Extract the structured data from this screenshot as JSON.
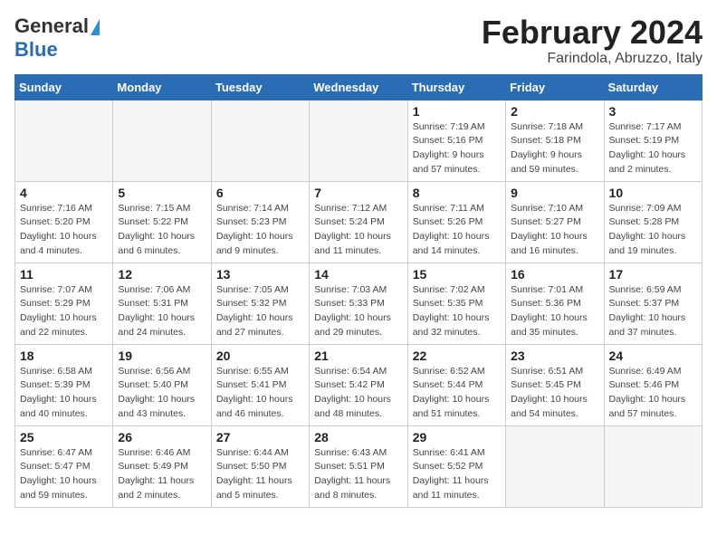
{
  "header": {
    "logo_general": "General",
    "logo_blue": "Blue",
    "month_title": "February 2024",
    "location": "Farindola, Abruzzo, Italy"
  },
  "weekdays": [
    "Sunday",
    "Monday",
    "Tuesday",
    "Wednesday",
    "Thursday",
    "Friday",
    "Saturday"
  ],
  "weeks": [
    [
      {
        "day": "",
        "sunrise": "",
        "sunset": "",
        "daylight": "",
        "empty": true
      },
      {
        "day": "",
        "sunrise": "",
        "sunset": "",
        "daylight": "",
        "empty": true
      },
      {
        "day": "",
        "sunrise": "",
        "sunset": "",
        "daylight": "",
        "empty": true
      },
      {
        "day": "",
        "sunrise": "",
        "sunset": "",
        "daylight": "",
        "empty": true
      },
      {
        "day": "1",
        "sunrise": "Sunrise: 7:19 AM",
        "sunset": "Sunset: 5:16 PM",
        "daylight": "Daylight: 9 hours and 57 minutes.",
        "empty": false
      },
      {
        "day": "2",
        "sunrise": "Sunrise: 7:18 AM",
        "sunset": "Sunset: 5:18 PM",
        "daylight": "Daylight: 9 hours and 59 minutes.",
        "empty": false
      },
      {
        "day": "3",
        "sunrise": "Sunrise: 7:17 AM",
        "sunset": "Sunset: 5:19 PM",
        "daylight": "Daylight: 10 hours and 2 minutes.",
        "empty": false
      }
    ],
    [
      {
        "day": "4",
        "sunrise": "Sunrise: 7:16 AM",
        "sunset": "Sunset: 5:20 PM",
        "daylight": "Daylight: 10 hours and 4 minutes.",
        "empty": false
      },
      {
        "day": "5",
        "sunrise": "Sunrise: 7:15 AM",
        "sunset": "Sunset: 5:22 PM",
        "daylight": "Daylight: 10 hours and 6 minutes.",
        "empty": false
      },
      {
        "day": "6",
        "sunrise": "Sunrise: 7:14 AM",
        "sunset": "Sunset: 5:23 PM",
        "daylight": "Daylight: 10 hours and 9 minutes.",
        "empty": false
      },
      {
        "day": "7",
        "sunrise": "Sunrise: 7:12 AM",
        "sunset": "Sunset: 5:24 PM",
        "daylight": "Daylight: 10 hours and 11 minutes.",
        "empty": false
      },
      {
        "day": "8",
        "sunrise": "Sunrise: 7:11 AM",
        "sunset": "Sunset: 5:26 PM",
        "daylight": "Daylight: 10 hours and 14 minutes.",
        "empty": false
      },
      {
        "day": "9",
        "sunrise": "Sunrise: 7:10 AM",
        "sunset": "Sunset: 5:27 PM",
        "daylight": "Daylight: 10 hours and 16 minutes.",
        "empty": false
      },
      {
        "day": "10",
        "sunrise": "Sunrise: 7:09 AM",
        "sunset": "Sunset: 5:28 PM",
        "daylight": "Daylight: 10 hours and 19 minutes.",
        "empty": false
      }
    ],
    [
      {
        "day": "11",
        "sunrise": "Sunrise: 7:07 AM",
        "sunset": "Sunset: 5:29 PM",
        "daylight": "Daylight: 10 hours and 22 minutes.",
        "empty": false
      },
      {
        "day": "12",
        "sunrise": "Sunrise: 7:06 AM",
        "sunset": "Sunset: 5:31 PM",
        "daylight": "Daylight: 10 hours and 24 minutes.",
        "empty": false
      },
      {
        "day": "13",
        "sunrise": "Sunrise: 7:05 AM",
        "sunset": "Sunset: 5:32 PM",
        "daylight": "Daylight: 10 hours and 27 minutes.",
        "empty": false
      },
      {
        "day": "14",
        "sunrise": "Sunrise: 7:03 AM",
        "sunset": "Sunset: 5:33 PM",
        "daylight": "Daylight: 10 hours and 29 minutes.",
        "empty": false
      },
      {
        "day": "15",
        "sunrise": "Sunrise: 7:02 AM",
        "sunset": "Sunset: 5:35 PM",
        "daylight": "Daylight: 10 hours and 32 minutes.",
        "empty": false
      },
      {
        "day": "16",
        "sunrise": "Sunrise: 7:01 AM",
        "sunset": "Sunset: 5:36 PM",
        "daylight": "Daylight: 10 hours and 35 minutes.",
        "empty": false
      },
      {
        "day": "17",
        "sunrise": "Sunrise: 6:59 AM",
        "sunset": "Sunset: 5:37 PM",
        "daylight": "Daylight: 10 hours and 37 minutes.",
        "empty": false
      }
    ],
    [
      {
        "day": "18",
        "sunrise": "Sunrise: 6:58 AM",
        "sunset": "Sunset: 5:39 PM",
        "daylight": "Daylight: 10 hours and 40 minutes.",
        "empty": false
      },
      {
        "day": "19",
        "sunrise": "Sunrise: 6:56 AM",
        "sunset": "Sunset: 5:40 PM",
        "daylight": "Daylight: 10 hours and 43 minutes.",
        "empty": false
      },
      {
        "day": "20",
        "sunrise": "Sunrise: 6:55 AM",
        "sunset": "Sunset: 5:41 PM",
        "daylight": "Daylight: 10 hours and 46 minutes.",
        "empty": false
      },
      {
        "day": "21",
        "sunrise": "Sunrise: 6:54 AM",
        "sunset": "Sunset: 5:42 PM",
        "daylight": "Daylight: 10 hours and 48 minutes.",
        "empty": false
      },
      {
        "day": "22",
        "sunrise": "Sunrise: 6:52 AM",
        "sunset": "Sunset: 5:44 PM",
        "daylight": "Daylight: 10 hours and 51 minutes.",
        "empty": false
      },
      {
        "day": "23",
        "sunrise": "Sunrise: 6:51 AM",
        "sunset": "Sunset: 5:45 PM",
        "daylight": "Daylight: 10 hours and 54 minutes.",
        "empty": false
      },
      {
        "day": "24",
        "sunrise": "Sunrise: 6:49 AM",
        "sunset": "Sunset: 5:46 PM",
        "daylight": "Daylight: 10 hours and 57 minutes.",
        "empty": false
      }
    ],
    [
      {
        "day": "25",
        "sunrise": "Sunrise: 6:47 AM",
        "sunset": "Sunset: 5:47 PM",
        "daylight": "Daylight: 10 hours and 59 minutes.",
        "empty": false
      },
      {
        "day": "26",
        "sunrise": "Sunrise: 6:46 AM",
        "sunset": "Sunset: 5:49 PM",
        "daylight": "Daylight: 11 hours and 2 minutes.",
        "empty": false
      },
      {
        "day": "27",
        "sunrise": "Sunrise: 6:44 AM",
        "sunset": "Sunset: 5:50 PM",
        "daylight": "Daylight: 11 hours and 5 minutes.",
        "empty": false
      },
      {
        "day": "28",
        "sunrise": "Sunrise: 6:43 AM",
        "sunset": "Sunset: 5:51 PM",
        "daylight": "Daylight: 11 hours and 8 minutes.",
        "empty": false
      },
      {
        "day": "29",
        "sunrise": "Sunrise: 6:41 AM",
        "sunset": "Sunset: 5:52 PM",
        "daylight": "Daylight: 11 hours and 11 minutes.",
        "empty": false
      },
      {
        "day": "",
        "sunrise": "",
        "sunset": "",
        "daylight": "",
        "empty": true
      },
      {
        "day": "",
        "sunrise": "",
        "sunset": "",
        "daylight": "",
        "empty": true
      }
    ]
  ]
}
